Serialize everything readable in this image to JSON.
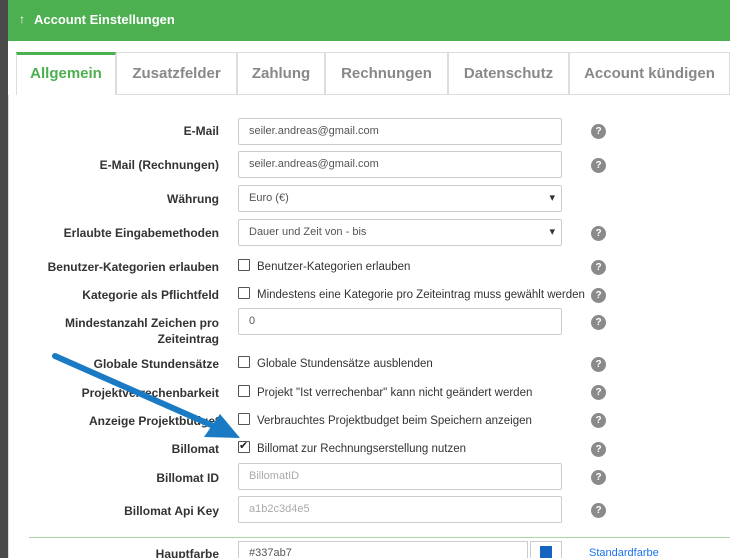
{
  "header": {
    "arrow_icon": "↑",
    "title": "Account Einstellungen"
  },
  "tabs": [
    {
      "label": "Allgemein"
    },
    {
      "label": "Zusatzfelder"
    },
    {
      "label": "Zahlung"
    },
    {
      "label": "Rechnungen"
    },
    {
      "label": "Datenschutz"
    },
    {
      "label": "Account kündigen"
    }
  ],
  "help_glyph": "?",
  "fields": {
    "email": {
      "label": "E-Mail",
      "value": "seiler.andreas@gmail.com"
    },
    "email_invoice": {
      "label": "E-Mail (Rechnungen)",
      "value": "seiler.andreas@gmail.com"
    },
    "currency": {
      "label": "Währung",
      "value": "Euro (€)"
    },
    "input_methods": {
      "label": "Erlaubte Eingabemethoden",
      "value": "Dauer und Zeit von - bis"
    },
    "user_categories": {
      "label": "Benutzer-Kategorien erlauben",
      "text": "Benutzer-Kategorien erlauben",
      "checked": false
    },
    "category_required": {
      "label": "Kategorie als Pflichtfeld",
      "text": "Mindestens eine Kategorie pro Zeiteintrag muss gewählt werden",
      "checked": false
    },
    "min_chars": {
      "label": "Mindestanzahl Zeichen pro Zeiteintrag",
      "value": "0"
    },
    "global_rates": {
      "label": "Globale Stundensätze",
      "text": "Globale Stundensätze ausblenden",
      "checked": false
    },
    "project_billable": {
      "label": "Projektverrechenbarkeit",
      "text": "Projekt \"Ist verrechenbar\" kann nicht geändert werden",
      "checked": false
    },
    "project_budget": {
      "label": "Anzeige Projektbudget",
      "text": "Verbrauchtes Projektbudget beim Speichern anzeigen",
      "checked": false
    },
    "billomat": {
      "label": "Billomat",
      "text": "Billomat zur Rechnungserstellung nutzen",
      "checked": true
    },
    "billomat_id": {
      "label": "Billomat ID",
      "placeholder": "BillomatID"
    },
    "billomat_key": {
      "label": "Billomat Api Key",
      "placeholder": "a1b2c3d4e5"
    }
  },
  "bottom": {
    "label": "Hauptfarbe",
    "value": "#337ab7",
    "link": "Standardfarbe"
  }
}
